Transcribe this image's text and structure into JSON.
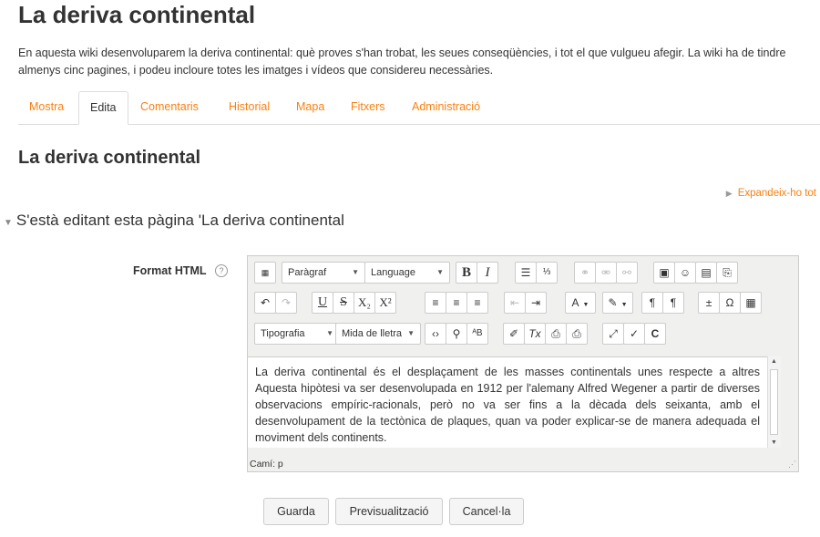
{
  "page": {
    "title": "La deriva continental",
    "intro": "En aquesta wiki desenvoluparem la deriva continental: què proves s'han trobat, les seues conseqüències, i tot el que vulgueu afegir. La wiki ha de tindre almenys cinc pagines, i podeu incloure totes les imatges i vídeos que considereu necessàries."
  },
  "tabs": [
    {
      "label": "Mostra",
      "active": false
    },
    {
      "label": "Edita",
      "active": true
    },
    {
      "label": "Comentaris",
      "active": false
    },
    {
      "label": "Historial",
      "active": false
    },
    {
      "label": "Mapa",
      "active": false
    },
    {
      "label": "Fitxers",
      "active": false
    },
    {
      "label": "Administració",
      "active": false
    }
  ],
  "section": {
    "heading": "La deriva continental",
    "expand_all": "Expandeix-ho tot",
    "editing_legend": "S'està editant esta pàgina 'La deriva continental"
  },
  "form": {
    "format_label": "Format HTML",
    "help_icon": "question-circle-icon"
  },
  "editor": {
    "paragraph_select": "Paràgraf",
    "language_select": "Language",
    "font_select": "Tipografia",
    "size_select": "Mida de lletra",
    "content": "La deriva continental és el desplaçament de les masses continentals unes respecte a altres Aquesta hipòtesi va ser desenvolupada en 1912 per l'alemany Alfred Wegener a partir de diverses observacions empíric-racionals, però no va ser fins a la dècada dels seixanta, amb el desenvolupament de la tectònica de plaques, quan va poder explicar-se de manera adequada el moviment dels continents.",
    "path": "Camí: p"
  },
  "buttons": {
    "save": "Guarda",
    "preview": "Previsualització",
    "cancel": "Cancel·la"
  },
  "colors": {
    "accent": "#f98012",
    "text": "#333333"
  }
}
